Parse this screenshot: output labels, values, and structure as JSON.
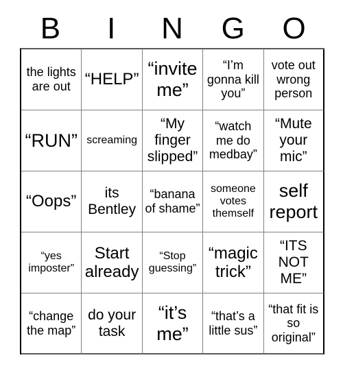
{
  "card": {
    "title": "BINGO",
    "header_letters": [
      "B",
      "I",
      "N",
      "G",
      "O"
    ],
    "grid_size": "5x5",
    "text_color": "#000000",
    "background_color": "#ffffff",
    "border_color": "#808080",
    "rows": [
      [
        {
          "text": "the lights are out",
          "size": "md"
        },
        {
          "text": "“HELP”",
          "size": "xl"
        },
        {
          "text": "“invite me”",
          "size": "xxl"
        },
        {
          "text": "“I’m gonna kill you”",
          "size": "md"
        },
        {
          "text": "vote out wrong person",
          "size": "md"
        }
      ],
      [
        {
          "text": "“RUN”",
          "size": "xxl"
        },
        {
          "text": "screaming",
          "size": "sm"
        },
        {
          "text": "“My finger slipped”",
          "size": "lg"
        },
        {
          "text": "“watch me do medbay”",
          "size": "md"
        },
        {
          "text": "“Mute your mic”",
          "size": "lg"
        }
      ],
      [
        {
          "text": "“Oops”",
          "size": "xl"
        },
        {
          "text": "its Bentley",
          "size": "lg"
        },
        {
          "text": "“banana of shame”",
          "size": "md"
        },
        {
          "text": "someone votes themself",
          "size": "sm"
        },
        {
          "text": "self report",
          "size": "xxl"
        }
      ],
      [
        {
          "text": "“yes imposter”",
          "size": "sm"
        },
        {
          "text": "Start already",
          "size": "xl"
        },
        {
          "text": "“Stop guessing”",
          "size": "sm"
        },
        {
          "text": "“magic trick”",
          "size": "xl"
        },
        {
          "text": "“ITS NOT ME”",
          "size": "lg"
        }
      ],
      [
        {
          "text": "“change the map”",
          "size": "md"
        },
        {
          "text": "do your task",
          "size": "lg"
        },
        {
          "text": "“it’s me”",
          "size": "xxl"
        },
        {
          "text": "“that’s a little sus”",
          "size": "md"
        },
        {
          "text": "“that fit is so original”",
          "size": "md"
        }
      ]
    ]
  }
}
